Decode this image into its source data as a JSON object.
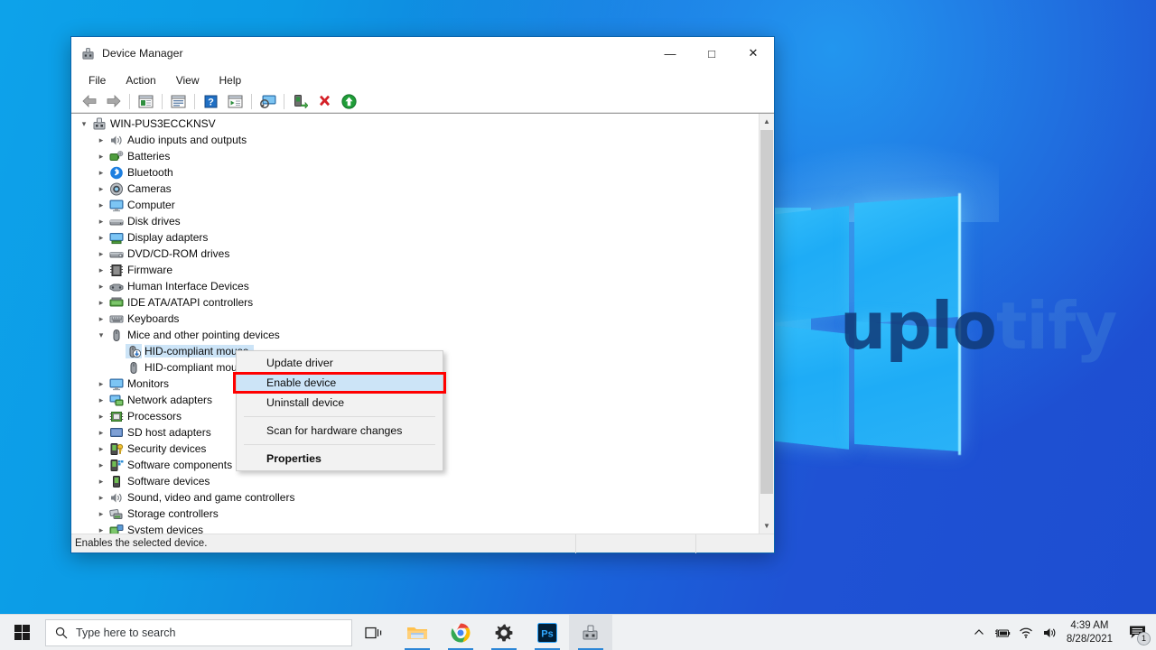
{
  "desktop": {
    "watermark_dark": "uplo",
    "watermark_light": "tify"
  },
  "window": {
    "title": "Device Manager",
    "app_icon": "device-manager-icon",
    "controls": {
      "minimize": "—",
      "maximize": "□",
      "close": "✕"
    },
    "menus": [
      "File",
      "Action",
      "View",
      "Help"
    ],
    "toolbar": [
      {
        "name": "back-button",
        "glyph": "back-arrow-icon"
      },
      {
        "name": "forward-button",
        "glyph": "forward-arrow-icon"
      },
      {
        "name": "show-hide-console-tree-button",
        "glyph": "console-tree-icon"
      },
      {
        "name": "properties-button",
        "glyph": "properties-icon"
      },
      {
        "name": "help-button",
        "glyph": "help-icon"
      },
      {
        "name": "show-hide-action-pane-button",
        "glyph": "action-pane-icon"
      },
      {
        "name": "scan-for-hardware-changes-button",
        "glyph": "scan-hardware-icon"
      },
      {
        "name": "enable-device-button",
        "glyph": "enable-device-icon"
      },
      {
        "name": "uninstall-device-button",
        "glyph": "uninstall-device-icon"
      },
      {
        "name": "update-driver-button",
        "glyph": "update-driver-icon"
      }
    ],
    "tree": {
      "root": {
        "label": "WIN-PUS3ECCKNSV",
        "expanded": true,
        "icon": "computer-node-icon"
      },
      "items": [
        {
          "label": "Audio inputs and outputs",
          "icon": "speaker-icon",
          "indent": 1,
          "expandable": true
        },
        {
          "label": "Batteries",
          "icon": "battery-icon",
          "indent": 1,
          "expandable": true
        },
        {
          "label": "Bluetooth",
          "icon": "bluetooth-icon",
          "indent": 1,
          "expandable": true
        },
        {
          "label": "Cameras",
          "icon": "camera-icon",
          "indent": 1,
          "expandable": true
        },
        {
          "label": "Computer",
          "icon": "monitor-icon",
          "indent": 1,
          "expandable": true
        },
        {
          "label": "Disk drives",
          "icon": "disk-drive-icon",
          "indent": 1,
          "expandable": true
        },
        {
          "label": "Display adapters",
          "icon": "display-adapter-icon",
          "indent": 1,
          "expandable": true
        },
        {
          "label": "DVD/CD-ROM drives",
          "icon": "optical-drive-icon",
          "indent": 1,
          "expandable": true
        },
        {
          "label": "Firmware",
          "icon": "firmware-icon",
          "indent": 1,
          "expandable": true
        },
        {
          "label": "Human Interface Devices",
          "icon": "hid-icon",
          "indent": 1,
          "expandable": true
        },
        {
          "label": "IDE ATA/ATAPI controllers",
          "icon": "ide-controller-icon",
          "indent": 1,
          "expandable": true
        },
        {
          "label": "Keyboards",
          "icon": "keyboard-icon",
          "indent": 1,
          "expandable": true
        },
        {
          "label": "Mice and other pointing devices",
          "icon": "mouse-icon",
          "indent": 1,
          "expandable": true,
          "expanded": true
        },
        {
          "label": "HID-compliant mouse",
          "icon": "mouse-disabled-icon",
          "indent": 2,
          "expandable": false,
          "selected": true
        },
        {
          "label": "HID-compliant mouse",
          "icon": "mouse-icon",
          "indent": 2,
          "expandable": false
        },
        {
          "label": "Monitors",
          "icon": "monitor-icon",
          "indent": 1,
          "expandable": true
        },
        {
          "label": "Network adapters",
          "icon": "network-adapter-icon",
          "indent": 1,
          "expandable": true
        },
        {
          "label": "Processors",
          "icon": "processor-icon",
          "indent": 1,
          "expandable": true
        },
        {
          "label": "SD host adapters",
          "icon": "sd-host-adapter-icon",
          "indent": 1,
          "expandable": true
        },
        {
          "label": "Security devices",
          "icon": "security-device-icon",
          "indent": 1,
          "expandable": true
        },
        {
          "label": "Software components",
          "icon": "software-component-icon",
          "indent": 1,
          "expandable": true
        },
        {
          "label": "Software devices",
          "icon": "software-device-icon",
          "indent": 1,
          "expandable": true
        },
        {
          "label": "Sound, video and game controllers",
          "icon": "sound-controller-icon",
          "indent": 1,
          "expandable": true
        },
        {
          "label": "Storage controllers",
          "icon": "storage-controller-icon",
          "indent": 1,
          "expandable": true
        },
        {
          "label": "System devices",
          "icon": "system-device-icon",
          "indent": 1,
          "expandable": true
        }
      ]
    },
    "context_menu": {
      "items": [
        {
          "label": "Update driver",
          "highlighted": false,
          "bold": false,
          "separator_after": false
        },
        {
          "label": "Enable device",
          "highlighted": true,
          "bold": false,
          "separator_after": false
        },
        {
          "label": "Uninstall device",
          "highlighted": false,
          "bold": false,
          "separator_after": true
        },
        {
          "label": "Scan for hardware changes",
          "highlighted": false,
          "bold": false,
          "separator_after": true
        },
        {
          "label": "Properties",
          "highlighted": false,
          "bold": true,
          "separator_after": false
        }
      ],
      "highlight_box_color": "#ff0000"
    },
    "status_bar": {
      "text": "Enables the selected device."
    }
  },
  "taskbar": {
    "start_icon": "windows-logo-icon",
    "search_placeholder": "Type here to search",
    "search_icon": "search-icon",
    "items": [
      {
        "name": "task-view-button",
        "icon": "task-view-icon",
        "active": false,
        "running": false
      },
      {
        "name": "file-explorer-button",
        "icon": "folder-icon",
        "active": false,
        "running": true
      },
      {
        "name": "chrome-button",
        "icon": "chrome-icon",
        "active": false,
        "running": true
      },
      {
        "name": "settings-button",
        "icon": "gear-icon",
        "active": false,
        "running": true
      },
      {
        "name": "photoshop-button",
        "icon": "photoshop-icon",
        "active": false,
        "running": true,
        "label": "Ps"
      },
      {
        "name": "device-manager-taskbar-button",
        "icon": "device-manager-icon",
        "active": true,
        "running": true
      }
    ],
    "tray": {
      "chevron": "show-hidden-icons-chevron",
      "icons": [
        "battery-icon",
        "wifi-icon",
        "volume-icon"
      ],
      "time": "4:39 AM",
      "date": "8/28/2021",
      "notification_icon": "action-center-icon",
      "notification_count": "1"
    }
  },
  "colors": {
    "selection_blue": "#cce4f7",
    "highlight_red": "#ff0000",
    "desktop_light_blue": "#0c9ae5",
    "desktop_deep_blue": "#1d4ed1",
    "taskbar_bg": "#eff1f3"
  }
}
